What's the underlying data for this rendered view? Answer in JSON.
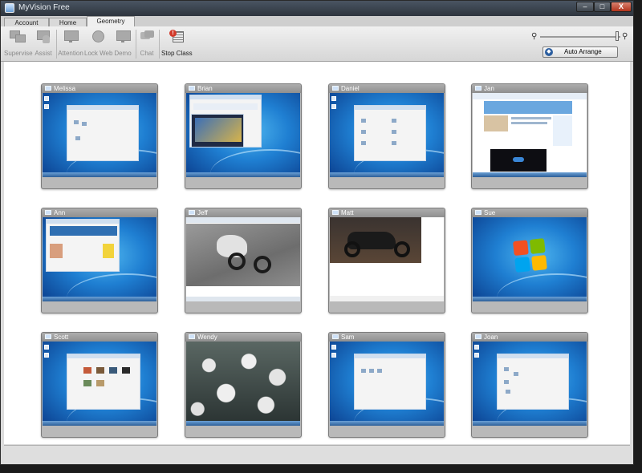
{
  "window": {
    "title": "MyVision Free",
    "controls": [
      "–",
      "□",
      "X"
    ]
  },
  "tabs": [
    {
      "label": "Account",
      "active": false
    },
    {
      "label": "Home",
      "active": false
    },
    {
      "label": "Geometry",
      "active": true
    }
  ],
  "ribbon": {
    "buttons": [
      {
        "label": "Supervise",
        "icon": "supervise-icon",
        "enabled": false
      },
      {
        "label": "Assist",
        "icon": "assist-hand-icon",
        "enabled": false
      },
      {
        "label": "Attention",
        "icon": "attention-monitor-icon",
        "enabled": false
      },
      {
        "label": "Lock Web",
        "icon": "lock-web-globe-icon",
        "enabled": false
      },
      {
        "label": "Demo",
        "icon": "demo-monitor-icon",
        "enabled": false
      },
      {
        "label": "Chat",
        "icon": "chat-bubble-icon",
        "enabled": false
      },
      {
        "label": "Stop Class",
        "icon": "stop-class-icon",
        "enabled": true
      }
    ],
    "zoom": {
      "level": 0.95,
      "min_icon": "zoom-out-icon",
      "max_icon": "zoom-in-icon"
    },
    "auto_arrange_label": "Auto Arrange"
  },
  "students": [
    {
      "name": "Melissa",
      "screen": "desktop-explorer"
    },
    {
      "name": "Brian",
      "screen": "desktop-browser-video"
    },
    {
      "name": "Daniel",
      "screen": "desktop-control-panel"
    },
    {
      "name": "Jan",
      "screen": "website"
    },
    {
      "name": "Ann",
      "screen": "desktop-browser"
    },
    {
      "name": "Jeff",
      "screen": "motorcycle-photo"
    },
    {
      "name": "Matt",
      "screen": "motorbike-photo"
    },
    {
      "name": "Sue",
      "screen": "windows-logo"
    },
    {
      "name": "Scott",
      "screen": "desktop-pictures"
    },
    {
      "name": "Wendy",
      "screen": "birds-photo"
    },
    {
      "name": "Sam",
      "screen": "desktop-explorer"
    },
    {
      "name": "Joan",
      "screen": "desktop-explorer"
    }
  ],
  "colors": {
    "desktop_blue": "#1f7fd2",
    "title_bar": "#3a434d",
    "close_red": "#c1432b",
    "stop_red": "#d23a2a"
  }
}
